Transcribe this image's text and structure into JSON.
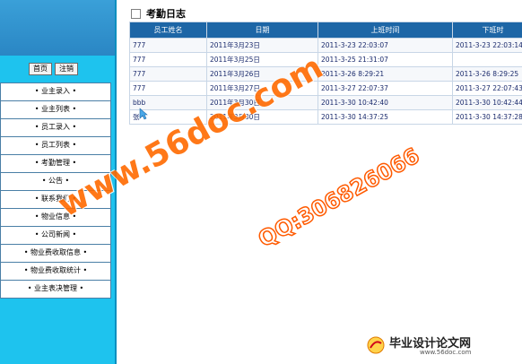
{
  "sidebar": {
    "top_buttons": [
      "首页",
      "注销"
    ],
    "menu": [
      "• 业主录入 •",
      "• 业主列表 •",
      "• 员工录入 •",
      "• 员工列表 •",
      "• 考勤管理 •",
      "• 公告 •",
      "• 联系我们 •",
      "• 物业信息 •",
      "• 公司新闻 •",
      "• 物业费收取信息 •",
      "• 物业费收取统计 •",
      "• 业主表决管理 •"
    ]
  },
  "main": {
    "title": "考勤日志",
    "table": {
      "headers": [
        "员工姓名",
        "日期",
        "上班时间",
        "下班时"
      ],
      "rows": [
        [
          "777",
          "2011年3月23日",
          "2011-3-23 22:03:07",
          "2011-3-23 22:03:14"
        ],
        [
          "777",
          "2011年3月25日",
          "2011-3-25 21:31:07",
          ""
        ],
        [
          "777",
          "2011年3月26日",
          "2011-3-26 8:29:21",
          "2011-3-26 8:29:25"
        ],
        [
          "777",
          "2011年3月27日",
          "2011-3-27 22:07:37",
          "2011-3-27 22:07:43"
        ],
        [
          "bbb",
          "2011年3月30日",
          "2011-3-30 10:42:40",
          "2011-3-30 10:42:44"
        ],
        [
          "张",
          "2011年3月30日",
          "2011-3-30 14:37:25",
          "2011-3-30 14:37:28"
        ]
      ]
    }
  },
  "watermark": {
    "url": "www.56doc.com",
    "qq": "QQ:306826066"
  },
  "footer_logo": {
    "title": "毕业设计论文网",
    "url": "www.56doc.com"
  },
  "colors": {
    "sidebar_bg": "#1ec3ee",
    "header_bg": "#1d66a6",
    "watermark": "#ff6a00"
  }
}
